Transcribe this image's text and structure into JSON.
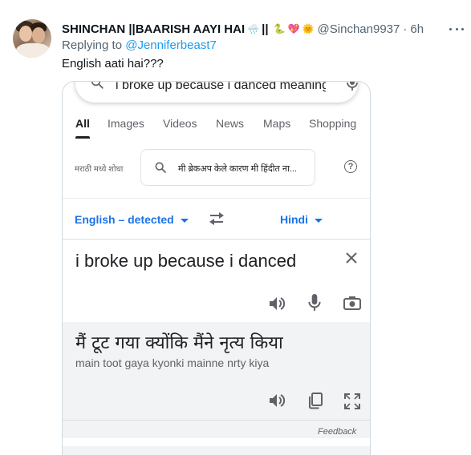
{
  "tweet": {
    "display_name": "SHINCHAN ||BAARISH AAYI HAI",
    "name_separator": "||",
    "name_emojis": [
      "🌧️",
      "🐍",
      "💖",
      "🌞"
    ],
    "handle": "@Sinchan9937",
    "dot": "·",
    "time": "6h",
    "replying_prefix": "Replying to",
    "replying_to": "@Jenniferbeast7",
    "text": "English aati hai???"
  },
  "google": {
    "query": "i broke up because i danced meaning",
    "tabs": [
      {
        "label": "All",
        "active": true
      },
      {
        "label": "Images",
        "active": false
      },
      {
        "label": "Videos",
        "active": false
      },
      {
        "label": "News",
        "active": false
      },
      {
        "label": "Maps",
        "active": false
      },
      {
        "label": "Shopping",
        "active": false
      }
    ],
    "marathi_label": "मराठी मध्ये शोधा",
    "marathi_query": "मी ब्रेकअप केले कारण मी हिंदीत ना...",
    "help_symbol": "?"
  },
  "translate": {
    "source_lang": "English – detected",
    "target_lang": "Hindi",
    "input_text": "i broke up because i danced",
    "output_text": "मैं टूट गया क्योंकि मैंने नृत्य किया",
    "transliteration": "main toot gaya kyonki mainne nrty kiya",
    "feedback": "Feedback"
  },
  "colors": {
    "twitter_blue": "#1d9bf0",
    "google_blue": "#1a73e8",
    "muted_text": "#536471",
    "output_bg": "#f1f3f4"
  },
  "icons": {
    "search": "search-icon",
    "mic": "mic-icon",
    "swap": "swap-icon",
    "clear": "close-icon",
    "speaker": "speaker-icon",
    "camera": "camera-icon",
    "copy": "copy-icon",
    "expand": "fullscreen-icon",
    "more": "more-icon"
  }
}
